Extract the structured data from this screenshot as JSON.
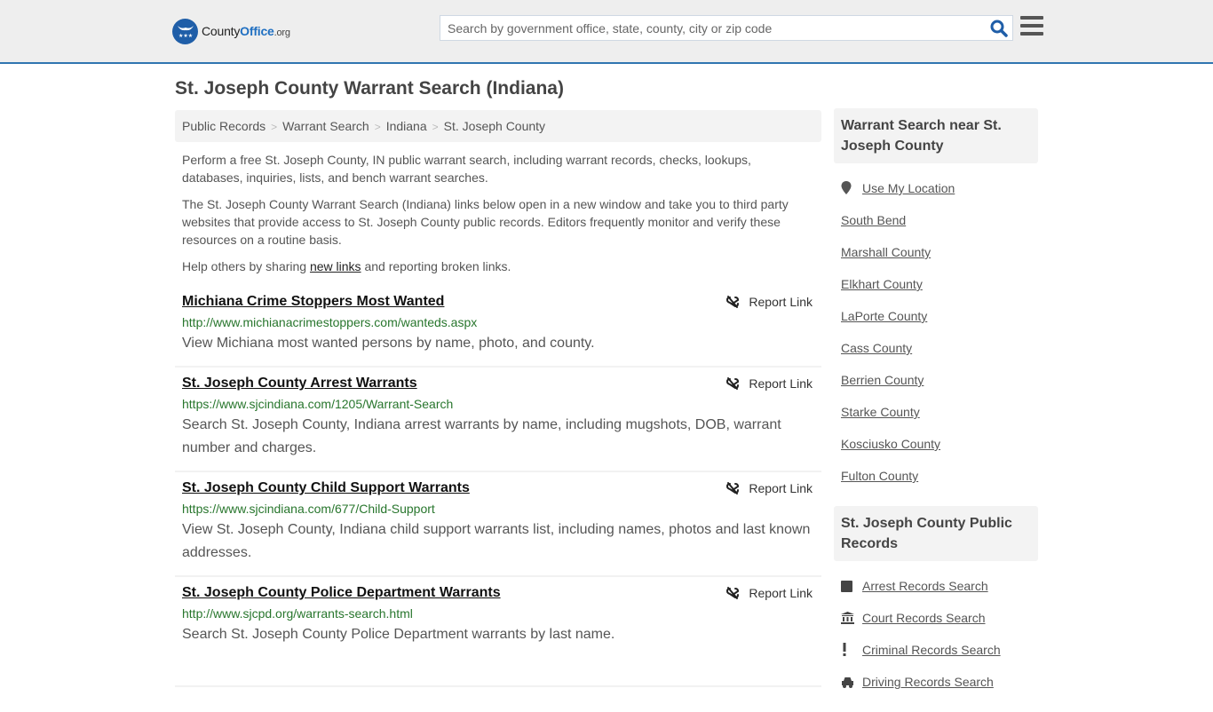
{
  "header": {
    "logo": {
      "county": "County",
      "office": "Office",
      "org": ".org"
    },
    "search_placeholder": "Search by government office, state, county, city or zip code",
    "search_value": "",
    "accent_color": "#2f75b0"
  },
  "page": {
    "title": "St. Joseph County Warrant Search (Indiana)"
  },
  "breadcrumb": [
    {
      "label": "Public Records"
    },
    {
      "label": "Warrant Search"
    },
    {
      "label": "Indiana"
    },
    {
      "label": "St. Joseph County"
    }
  ],
  "intro": {
    "p1": "Perform a free St. Joseph County, IN public warrant search, including warrant records, checks, lookups, databases, inquiries, lists, and bench warrant searches.",
    "p2": "The St. Joseph County Warrant Search (Indiana) links below open in a new window and take you to third party websites that provide access to St. Joseph County public records. Editors frequently monitor and verify these resources on a routine basis.",
    "p3_before": "Help others by sharing ",
    "p3_link": "new links",
    "p3_after": " and reporting broken links."
  },
  "results": [
    {
      "title": "Michiana Crime Stoppers Most Wanted",
      "url": "http://www.michianacrimestoppers.com/wanteds.aspx",
      "description": "View Michiana most wanted persons by name, photo, and county.",
      "report_label": "Report Link"
    },
    {
      "title": "St. Joseph County Arrest Warrants",
      "url": "https://www.sjcindiana.com/1205/Warrant-Search",
      "description": "Search St. Joseph County, Indiana arrest warrants by name, including mugshots, DOB, warrant number and charges.",
      "report_label": "Report Link"
    },
    {
      "title": "St. Joseph County Child Support Warrants",
      "url": "https://www.sjcindiana.com/677/Child-Support",
      "description": "View St. Joseph County, Indiana child support warrants list, including names, photos and last known addresses.",
      "report_label": "Report Link"
    },
    {
      "title": "St. Joseph County Police Department Warrants",
      "url": "http://www.sjcpd.org/warrants-search.html",
      "description": "Search St. Joseph County Police Department warrants by last name.",
      "report_label": "Report Link"
    }
  ],
  "sidebar": {
    "nearby": {
      "header": "Warrant Search near St. Joseph County",
      "use_location": "Use My Location",
      "items": [
        "South Bend",
        "Marshall County",
        "Elkhart County",
        "LaPorte County",
        "Cass County",
        "Berrien County",
        "Starke County",
        "Kosciusko County",
        "Fulton County"
      ]
    },
    "public_records": {
      "header": "St. Joseph County Public Records",
      "items": [
        {
          "label": "Arrest Records Search",
          "icon": "square-icon"
        },
        {
          "label": "Court Records Search",
          "icon": "courthouse-icon"
        },
        {
          "label": "Criminal Records Search",
          "icon": "exclamation-icon"
        },
        {
          "label": "Driving Records Search",
          "icon": "car-icon"
        }
      ]
    }
  }
}
